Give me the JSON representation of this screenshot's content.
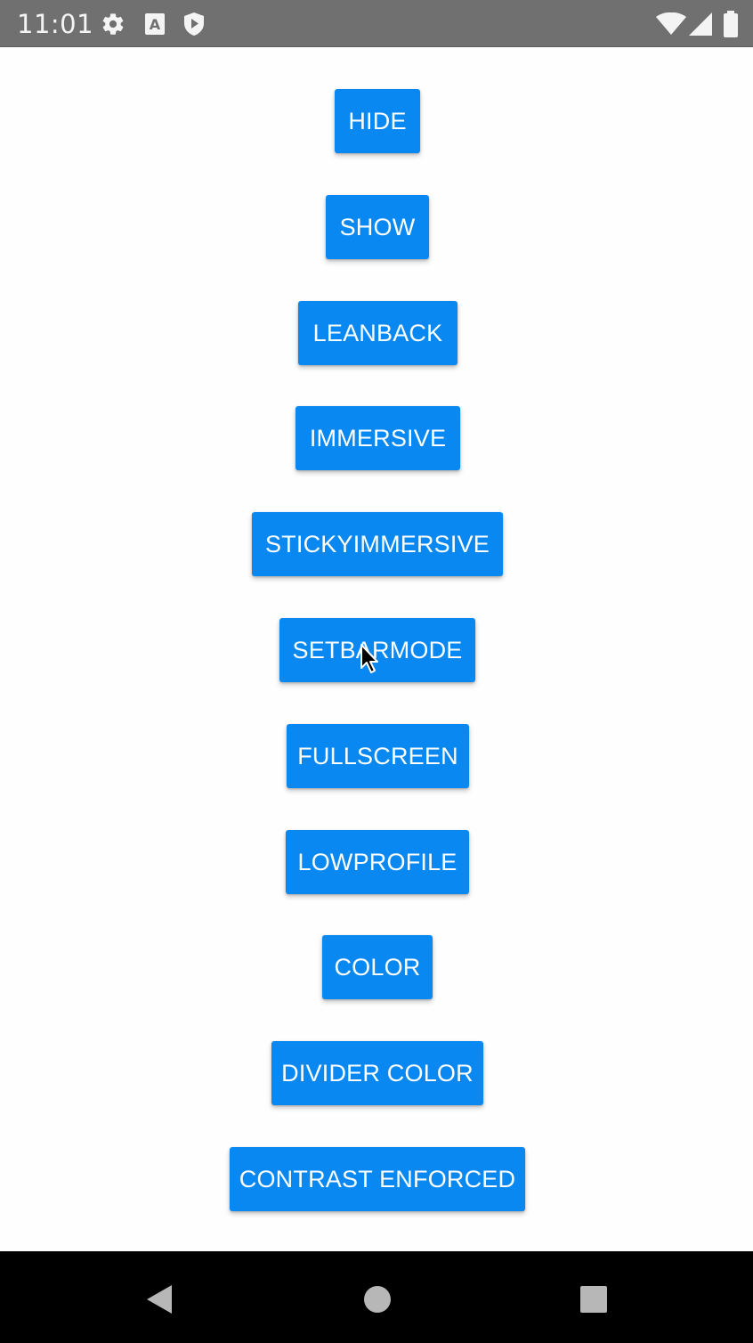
{
  "status_bar": {
    "time": "11:01",
    "left_icons": [
      "gear-icon",
      "text-a-icon",
      "shield-play-icon"
    ],
    "right_icons": [
      "wifi-icon",
      "cellular-signal-icon",
      "battery-icon"
    ]
  },
  "buttons": [
    {
      "id": "hide",
      "label": "HIDE"
    },
    {
      "id": "show",
      "label": "SHOW"
    },
    {
      "id": "leanback",
      "label": "LEANBACK"
    },
    {
      "id": "immersive",
      "label": "IMMERSIVE"
    },
    {
      "id": "stickyimmersive",
      "label": "STICKYIMMERSIVE"
    },
    {
      "id": "setbarmode",
      "label": "SETBARMODE"
    },
    {
      "id": "fullscreen",
      "label": "FULLSCREEN"
    },
    {
      "id": "lowprofile",
      "label": "LOWPROFILE"
    },
    {
      "id": "color",
      "label": "COLOR"
    },
    {
      "id": "divider-color",
      "label": "DIVIDER COLOR"
    },
    {
      "id": "contrast-enforced",
      "label": "CONTRAST ENFORCED"
    }
  ],
  "nav_bar": {
    "icons": [
      "back-triangle-icon",
      "home-circle-icon",
      "recents-square-icon"
    ]
  },
  "colors": {
    "button": "#0a88f1",
    "button_text": "#ffffff",
    "status_bar": "#707070",
    "nav_bar": "#000000",
    "background": "#fefefe"
  }
}
